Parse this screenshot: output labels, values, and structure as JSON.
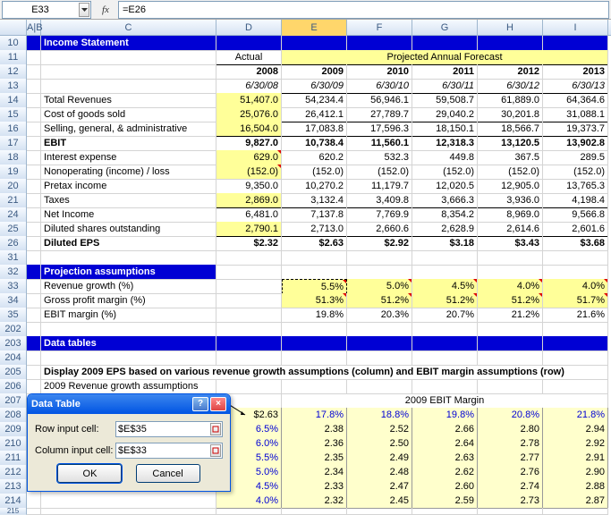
{
  "formula_bar": {
    "name_box": "E33",
    "fx": "fx",
    "formula": "=E26"
  },
  "columns": [
    "",
    "A|B",
    "C",
    "D",
    "E",
    "F",
    "G",
    "H",
    "I"
  ],
  "income": {
    "title": "Income Statement",
    "actual": "Actual",
    "forecast": "Projected Annual Forecast",
    "years": [
      "2008",
      "2009",
      "2010",
      "2011",
      "2012",
      "2013"
    ],
    "dates": [
      "6/30/08",
      "6/30/09",
      "6/30/10",
      "6/30/11",
      "6/30/12",
      "6/30/13"
    ],
    "rows": [
      {
        "r": "14",
        "label": "Total Revenues",
        "v": [
          "51,407.0",
          "54,234.4",
          "56,946.1",
          "59,508.7",
          "61,889.0",
          "64,364.6"
        ],
        "yellow0": true
      },
      {
        "r": "15",
        "label": "Cost of goods sold",
        "v": [
          "25,076.0",
          "26,412.1",
          "27,789.7",
          "29,040.2",
          "30,201.8",
          "31,088.1"
        ],
        "yellow0": true,
        "ul": true
      },
      {
        "r": "16",
        "label": "Selling, general, & administrative",
        "v": [
          "16,504.0",
          "17,083.8",
          "17,596.3",
          "18,150.1",
          "18,566.7",
          "19,373.7"
        ],
        "yellow0": true,
        "ul": true
      },
      {
        "r": "17",
        "label": "EBIT",
        "v": [
          "9,827.0",
          "10,738.4",
          "11,560.1",
          "12,318.3",
          "13,120.5",
          "13,902.8"
        ],
        "bold": true
      },
      {
        "r": "18",
        "label": "Interest expense",
        "v": [
          "629.0",
          "620.2",
          "532.3",
          "449.8",
          "367.5",
          "289.5"
        ],
        "yellow0": true,
        "tri": true
      },
      {
        "r": "19",
        "label": "Nonoperating (income) / loss",
        "v": [
          "(152.0)",
          "(152.0)",
          "(152.0)",
          "(152.0)",
          "(152.0)",
          "(152.0)"
        ],
        "yellow0": true,
        "tri": true
      },
      {
        "r": "20",
        "label": "Pretax income",
        "v": [
          "9,350.0",
          "10,270.2",
          "11,179.7",
          "12,020.5",
          "12,905.0",
          "13,765.3"
        ]
      },
      {
        "r": "21",
        "label": "Taxes",
        "v": [
          "2,869.0",
          "3,132.4",
          "3,409.8",
          "3,666.3",
          "3,936.0",
          "4,198.4"
        ],
        "yellow0": true,
        "ul": true
      },
      {
        "r": "24",
        "label": "Net Income",
        "v": [
          "6,481.0",
          "7,137.8",
          "7,769.9",
          "8,354.2",
          "8,969.0",
          "9,566.8"
        ]
      },
      {
        "r": "25",
        "label": "Diluted shares outstanding",
        "v": [
          "2,790.1",
          "2,713.0",
          "2,660.6",
          "2,628.9",
          "2,614.6",
          "2,601.6"
        ],
        "yellow0": true,
        "ul": true
      },
      {
        "r": "26",
        "label": "Diluted EPS",
        "v": [
          "$2.32",
          "$2.63",
          "$2.92",
          "$3.18",
          "$3.43",
          "$3.68"
        ],
        "bold": true
      }
    ]
  },
  "assumptions": {
    "title": "Projection assumptions",
    "rows": [
      {
        "r": "33",
        "label": "Revenue growth (%)",
        "v": [
          "",
          "5.5%",
          "5.0%",
          "4.5%",
          "4.0%",
          "4.0%"
        ],
        "yellow": true,
        "tri": true,
        "marching": 1
      },
      {
        "r": "34",
        "label": "Gross profit margin (%)",
        "v": [
          "",
          "51.3%",
          "51.2%",
          "51.2%",
          "51.2%",
          "51.7%"
        ],
        "yellow": true,
        "tri": true
      },
      {
        "r": "35",
        "label": "EBIT margin (%)",
        "v": [
          "",
          "19.8%",
          "20.3%",
          "20.7%",
          "21.2%",
          "21.6%"
        ]
      }
    ]
  },
  "data_tables": {
    "title": "Data tables"
  },
  "display": "Display 2009 EPS based on various revenue growth assumptions (column) and EBIT margin assumptions (row)",
  "sub206": "2009 Revenue growth assumptions",
  "dt": {
    "ebit_title": "2009 EBIT Margin",
    "ebit_margins": [
      "17.8%",
      "18.8%",
      "19.8%",
      "20.8%",
      "21.8%"
    ],
    "corner": "$2.63",
    "rows": [
      {
        "r": "209",
        "g": "6.5%",
        "v": [
          "2.38",
          "2.52",
          "2.66",
          "2.80",
          "2.94"
        ]
      },
      {
        "r": "210",
        "g": "6.0%",
        "v": [
          "2.36",
          "2.50",
          "2.64",
          "2.78",
          "2.92"
        ]
      },
      {
        "r": "211",
        "g": "5.5%",
        "v": [
          "2.35",
          "2.49",
          "2.63",
          "2.77",
          "2.91"
        ]
      },
      {
        "r": "212",
        "g": "5.0%",
        "v": [
          "2.34",
          "2.48",
          "2.62",
          "2.76",
          "2.90"
        ]
      },
      {
        "r": "213",
        "g": "4.5%",
        "v": [
          "2.33",
          "2.47",
          "2.60",
          "2.74",
          "2.88"
        ]
      },
      {
        "r": "214",
        "g": "4.0%",
        "v": [
          "2.32",
          "2.45",
          "2.59",
          "2.73",
          "2.87"
        ]
      }
    ]
  },
  "dialog": {
    "title": "Data Table",
    "row_label": "Row input cell:",
    "col_label": "Column input cell:",
    "row_val": "$E$35",
    "col_val": "$E$33",
    "ok": "OK",
    "cancel": "Cancel"
  },
  "chart_data": {
    "type": "table",
    "title": "2009 EPS sensitivity",
    "x_label": "2009 EBIT Margin",
    "y_label": "2009 Revenue growth",
    "x": [
      17.8,
      18.8,
      19.8,
      20.8,
      21.8
    ],
    "y": [
      6.5,
      6.0,
      5.5,
      5.0,
      4.5,
      4.0
    ],
    "z": [
      [
        2.38,
        2.52,
        2.66,
        2.8,
        2.94
      ],
      [
        2.36,
        2.5,
        2.64,
        2.78,
        2.92
      ],
      [
        2.35,
        2.49,
        2.63,
        2.77,
        2.91
      ],
      [
        2.34,
        2.48,
        2.62,
        2.76,
        2.9
      ],
      [
        2.33,
        2.47,
        2.6,
        2.74,
        2.88
      ],
      [
        2.32,
        2.45,
        2.59,
        2.73,
        2.87
      ]
    ]
  }
}
